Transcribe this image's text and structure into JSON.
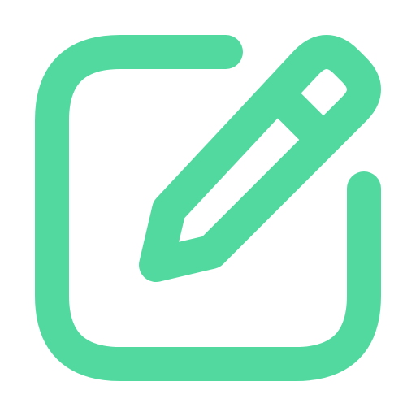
{
  "icon": {
    "name": "edit-icon",
    "color": "#52D9A0",
    "background": "#ffffff"
  }
}
